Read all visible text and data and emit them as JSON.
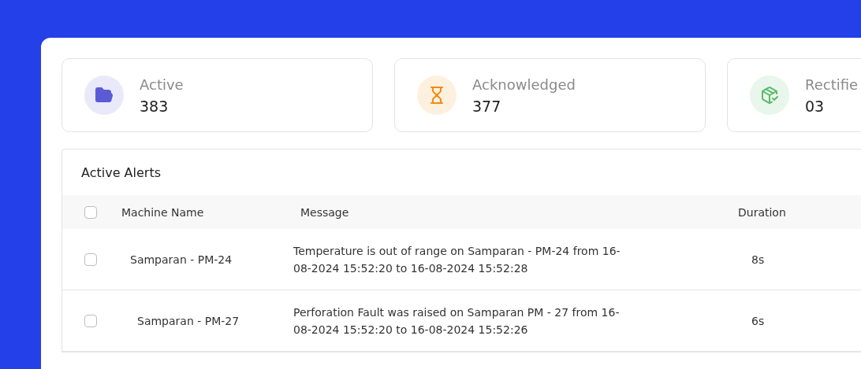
{
  "stats": [
    {
      "kind": "folder",
      "label": "Active",
      "value": "383",
      "color": "#5b5bd6"
    },
    {
      "kind": "hourglass",
      "label": "Acknowledged",
      "value": "377",
      "color": "#f28c0f"
    },
    {
      "kind": "box",
      "label": "Rectifie",
      "value": "03",
      "color": "#5cb96a"
    }
  ],
  "table": {
    "title": "Active Alerts",
    "header_checked": false,
    "columns": [
      "Machine Name",
      "Message",
      "Duration"
    ],
    "rows": [
      {
        "checked": false,
        "machine": "Samparan - PM-24",
        "message": "Temperature is out of range on Samparan - PM-24 from 16-08-2024 15:52:20 to 16-08-2024 15:52:28",
        "duration": "8s"
      },
      {
        "checked": false,
        "machine": "Samparan - PM-27",
        "message": "Perforation Fault was raised on Samparan PM - 27 from 16-08-2024 15:52:20 to 16-08-2024 15:52:26",
        "duration": "6s"
      }
    ]
  }
}
